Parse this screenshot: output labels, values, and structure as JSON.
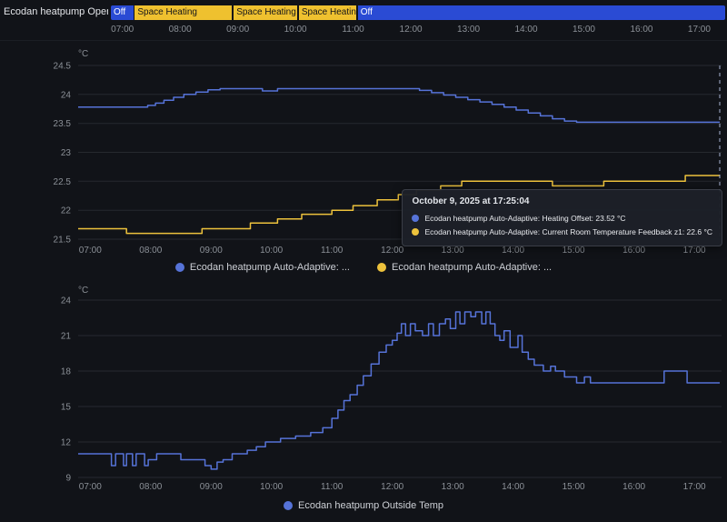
{
  "theme": {
    "background": "#111318",
    "grid": "#26292f",
    "axis_text": "#8b9097",
    "cursor": "#a9b4d4",
    "blue": "#5673d8",
    "yellow": "#edc23c"
  },
  "timeline": {
    "entity_label": "Ecodan heatpump Operation Mo...",
    "segments": [
      {
        "label": "Off",
        "start_pct": 0,
        "end_pct": 3.7,
        "color": "#2a4bd4",
        "text_color": "#ffffff"
      },
      {
        "label": "Space Heating",
        "start_pct": 3.9,
        "end_pct": 19.7,
        "color": "#efc12f",
        "text_color": "#15161a"
      },
      {
        "label": "Space Heating",
        "start_pct": 20.0,
        "end_pct": 30.3,
        "color": "#efc12f",
        "text_color": "#15161a"
      },
      {
        "label": "Space Heating",
        "start_pct": 30.6,
        "end_pct": 39.9,
        "color": "#efc12f",
        "text_color": "#15161a"
      },
      {
        "label": "Off",
        "start_pct": 40.2,
        "end_pct": 100,
        "color": "#2a4bd4",
        "text_color": "#ffffff"
      }
    ]
  },
  "time_axis": {
    "start": 6.8,
    "end": 17.45,
    "ticks": [
      {
        "t": 7,
        "label": "07:00"
      },
      {
        "t": 8,
        "label": "08:00"
      },
      {
        "t": 9,
        "label": "09:00"
      },
      {
        "t": 10,
        "label": "10:00"
      },
      {
        "t": 11,
        "label": "11:00"
      },
      {
        "t": 12,
        "label": "12:00"
      },
      {
        "t": 13,
        "label": "13:00"
      },
      {
        "t": 14,
        "label": "14:00"
      },
      {
        "t": 15,
        "label": "15:00"
      },
      {
        "t": 16,
        "label": "16:00"
      },
      {
        "t": 17,
        "label": "17:00"
      }
    ]
  },
  "chart_data": [
    {
      "type": "line",
      "unit": "°C",
      "y_domain": [
        21.5,
        24.5
      ],
      "y_ticks": [
        24.5,
        24,
        23.5,
        23,
        22.5,
        22,
        21.5
      ],
      "cursor_t": 17.42,
      "legend": [
        "Ecodan heatpump Auto-Adaptive: ...",
        "Ecodan heatpump Auto-Adaptive: ..."
      ],
      "series": [
        {
          "name": "Ecodan heatpump Auto-Adaptive: Heating Offset",
          "color": "#5673d8",
          "points": [
            [
              6.8,
              23.78
            ],
            [
              7.95,
              23.81
            ],
            [
              8.08,
              23.85
            ],
            [
              8.22,
              23.9
            ],
            [
              8.38,
              23.95
            ],
            [
              8.55,
              24.0
            ],
            [
              8.75,
              24.04
            ],
            [
              8.95,
              24.08
            ],
            [
              9.15,
              24.1
            ],
            [
              9.85,
              24.06
            ],
            [
              10.1,
              24.1
            ],
            [
              12.45,
              24.07
            ],
            [
              12.65,
              24.03
            ],
            [
              12.85,
              23.99
            ],
            [
              13.05,
              23.95
            ],
            [
              13.25,
              23.91
            ],
            [
              13.45,
              23.87
            ],
            [
              13.65,
              23.83
            ],
            [
              13.85,
              23.78
            ],
            [
              14.05,
              23.73
            ],
            [
              14.25,
              23.68
            ],
            [
              14.45,
              23.63
            ],
            [
              14.65,
              23.58
            ],
            [
              14.85,
              23.54
            ],
            [
              15.05,
              23.52
            ],
            [
              17.42,
              23.52
            ]
          ]
        },
        {
          "name": "Ecodan heatpump Auto-Adaptive: Current Room Temperature Feedback z1",
          "color": "#edc23c",
          "points": [
            [
              6.8,
              21.68
            ],
            [
              7.6,
              21.6
            ],
            [
              8.85,
              21.68
            ],
            [
              9.65,
              21.78
            ],
            [
              10.1,
              21.85
            ],
            [
              10.5,
              21.93
            ],
            [
              11.0,
              22.0
            ],
            [
              11.35,
              22.08
            ],
            [
              11.75,
              22.18
            ],
            [
              12.1,
              22.27
            ],
            [
              12.4,
              22.35
            ],
            [
              12.8,
              22.42
            ],
            [
              13.15,
              22.5
            ],
            [
              14.65,
              22.42
            ],
            [
              15.5,
              22.5
            ],
            [
              16.85,
              22.6
            ],
            [
              17.42,
              22.6
            ]
          ]
        }
      ]
    },
    {
      "type": "line",
      "unit": "°C",
      "y_domain": [
        9,
        24
      ],
      "y_ticks": [
        24,
        21,
        18,
        15,
        12,
        9
      ],
      "legend": [
        "Ecodan heatpump Outside Temp"
      ],
      "series": [
        {
          "name": "Ecodan heatpump Outside Temp",
          "color": "#5673d8",
          "points": [
            [
              6.8,
              11
            ],
            [
              7.35,
              10
            ],
            [
              7.42,
              11
            ],
            [
              7.55,
              10
            ],
            [
              7.6,
              11
            ],
            [
              7.7,
              10
            ],
            [
              7.76,
              11
            ],
            [
              7.9,
              10
            ],
            [
              7.96,
              10.5
            ],
            [
              8.1,
              11
            ],
            [
              8.5,
              10.5
            ],
            [
              8.8,
              10.5
            ],
            [
              8.9,
              10
            ],
            [
              9.0,
              9.7
            ],
            [
              9.1,
              10.3
            ],
            [
              9.2,
              10.5
            ],
            [
              9.35,
              11
            ],
            [
              9.6,
              11.3
            ],
            [
              9.75,
              11.6
            ],
            [
              9.9,
              12
            ],
            [
              10.15,
              12.3
            ],
            [
              10.4,
              12.5
            ],
            [
              10.65,
              12.8
            ],
            [
              10.85,
              13.2
            ],
            [
              11.0,
              14
            ],
            [
              11.1,
              14.7
            ],
            [
              11.2,
              15.5
            ],
            [
              11.3,
              16
            ],
            [
              11.42,
              16.8
            ],
            [
              11.52,
              17.6
            ],
            [
              11.65,
              18.6
            ],
            [
              11.78,
              19.6
            ],
            [
              11.9,
              20.2
            ],
            [
              12.0,
              20.6
            ],
            [
              12.08,
              21.2
            ],
            [
              12.15,
              22
            ],
            [
              12.22,
              21
            ],
            [
              12.3,
              22
            ],
            [
              12.38,
              21.4
            ],
            [
              12.5,
              21
            ],
            [
              12.6,
              22
            ],
            [
              12.68,
              21
            ],
            [
              12.78,
              22
            ],
            [
              12.88,
              22.4
            ],
            [
              12.96,
              21.6
            ],
            [
              13.05,
              23
            ],
            [
              13.12,
              22
            ],
            [
              13.2,
              23
            ],
            [
              13.3,
              22.6
            ],
            [
              13.38,
              23
            ],
            [
              13.48,
              22
            ],
            [
              13.55,
              23
            ],
            [
              13.62,
              22
            ],
            [
              13.7,
              21
            ],
            [
              13.78,
              20.6
            ],
            [
              13.85,
              21.4
            ],
            [
              13.95,
              20
            ],
            [
              14.08,
              21
            ],
            [
              14.15,
              19.6
            ],
            [
              14.25,
              19
            ],
            [
              14.35,
              18.5
            ],
            [
              14.5,
              18
            ],
            [
              14.62,
              18.4
            ],
            [
              14.7,
              18
            ],
            [
              14.85,
              17.5
            ],
            [
              15.05,
              17
            ],
            [
              15.18,
              17.5
            ],
            [
              15.28,
              17
            ],
            [
              16.5,
              18
            ],
            [
              16.88,
              17
            ],
            [
              17.42,
              17
            ]
          ]
        }
      ]
    }
  ],
  "tooltip": {
    "title": "October 9, 2025 at 17:25:04",
    "rows": [
      {
        "color": "#5673d8",
        "text": "Ecodan heatpump Auto-Adaptive: Heating Offset: 23.52 °C"
      },
      {
        "color": "#edc23c",
        "text": "Ecodan heatpump Auto-Adaptive: Current Room Temperature Feedback z1: 22.6 °C"
      }
    ]
  }
}
